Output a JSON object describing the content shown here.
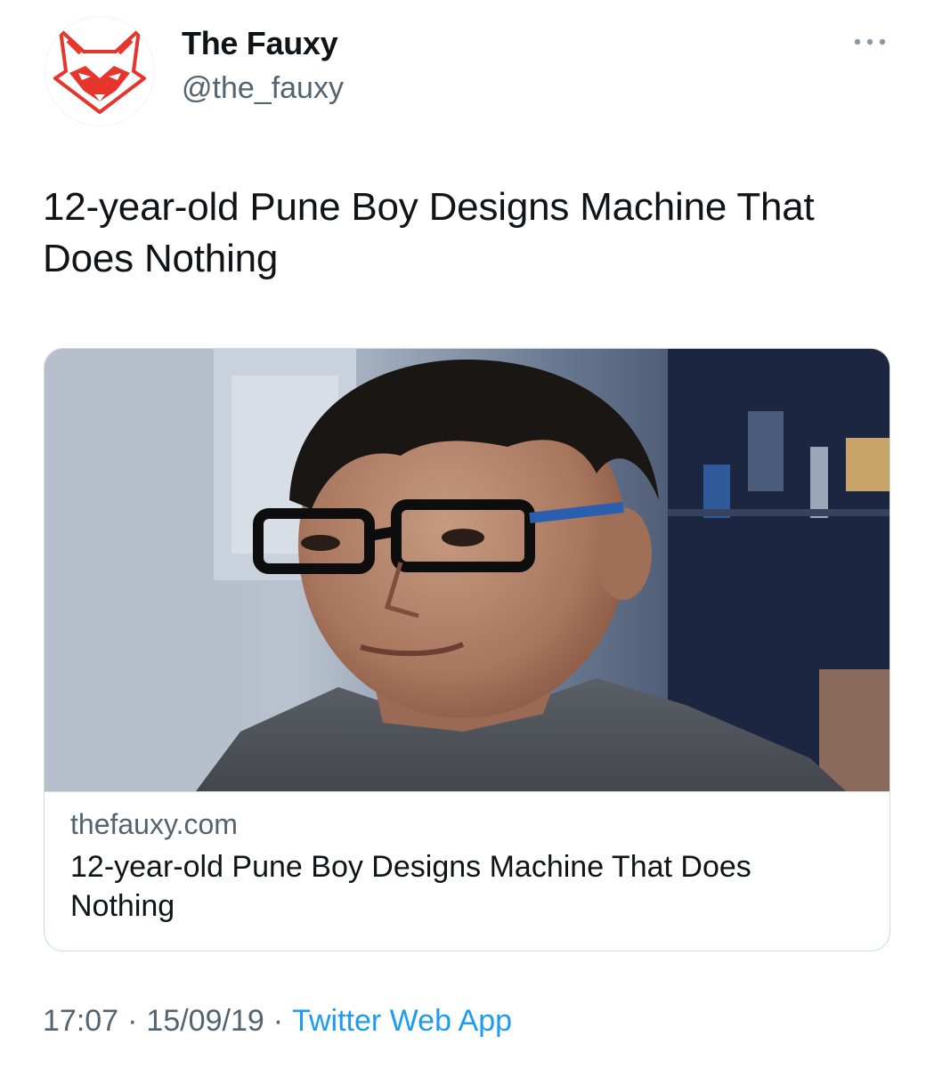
{
  "author": {
    "display_name": "The Fauxy",
    "handle": "@the_fauxy",
    "avatar_icon": "fox-logo-icon",
    "brand_color": "#e8352b"
  },
  "more_icon": "ellipsis-icon",
  "tweet": {
    "text": "12-year-old Pune Boy Designs Machine That Does Nothing"
  },
  "card": {
    "image_icon": "photo-boy-with-glasses",
    "domain": "thefauxy.com",
    "title": "12-year-old Pune Boy Designs Machine That Does Nothing"
  },
  "meta": {
    "time": "17:07",
    "date": "15/09/19",
    "separator": "·",
    "source": "Twitter Web App",
    "link_color": "#1d9bf0"
  }
}
